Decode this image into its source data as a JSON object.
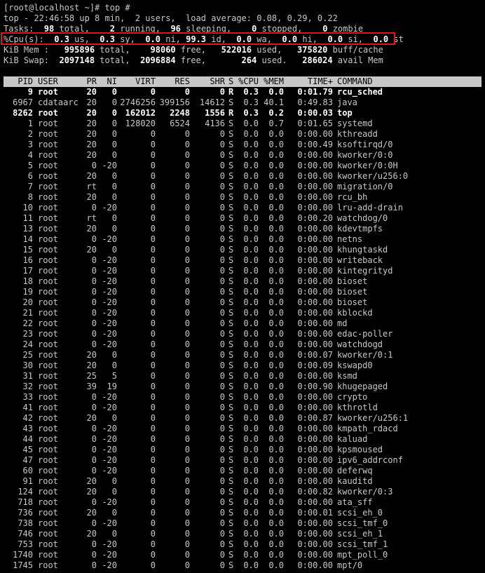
{
  "prompt": "[root@localhost ~]# top #",
  "summary": {
    "top": "top - 22:46:58 up 8 min,  2 users,  load average: 0.08, 0.29, 0.22",
    "tasks": [
      {
        "t": "Tasks: ",
        "b": false
      },
      {
        "t": " 98",
        "b": true
      },
      {
        "t": " total,  ",
        "b": false
      },
      {
        "t": "  2",
        "b": true
      },
      {
        "t": " running, ",
        "b": false
      },
      {
        "t": " 96",
        "b": true
      },
      {
        "t": " sleeping,  ",
        "b": false
      },
      {
        "t": "  0",
        "b": true
      },
      {
        "t": " stopped,  ",
        "b": false
      },
      {
        "t": "  0",
        "b": true
      },
      {
        "t": " zombie",
        "b": false
      }
    ],
    "cpu": [
      {
        "t": "%Cpu(s): ",
        "b": false
      },
      {
        "t": " 0.3",
        "b": true
      },
      {
        "t": " us, ",
        "b": false
      },
      {
        "t": " 0.3",
        "b": true
      },
      {
        "t": " sy, ",
        "b": false
      },
      {
        "t": " 0.0",
        "b": true
      },
      {
        "t": " ni, ",
        "b": false
      },
      {
        "t": "99.3",
        "b": true
      },
      {
        "t": " id, ",
        "b": false
      },
      {
        "t": " 0.0",
        "b": true
      },
      {
        "t": " wa, ",
        "b": false
      },
      {
        "t": " 0.0",
        "b": true
      },
      {
        "t": " hi, ",
        "b": false
      },
      {
        "t": " 0.0",
        "b": true
      },
      {
        "t": " si, ",
        "b": false
      },
      {
        "t": " 0.0",
        "b": true
      },
      {
        "t": " st",
        "b": false
      }
    ],
    "mem": [
      {
        "t": "KiB Mem : ",
        "b": false
      },
      {
        "t": "  995896",
        "b": true
      },
      {
        "t": " total,  ",
        "b": false
      },
      {
        "t": "  98060",
        "b": true
      },
      {
        "t": " free,  ",
        "b": false
      },
      {
        "t": " 522016",
        "b": true
      },
      {
        "t": " used,  ",
        "b": false
      },
      {
        "t": " 375820",
        "b": true
      },
      {
        "t": " buff/cache",
        "b": false
      }
    ],
    "swap": [
      {
        "t": "KiB Swap: ",
        "b": false
      },
      {
        "t": " 2097148",
        "b": true
      },
      {
        "t": " total, ",
        "b": false
      },
      {
        "t": " 2096884",
        "b": true
      },
      {
        "t": " free,  ",
        "b": false
      },
      {
        "t": "     264",
        "b": true
      },
      {
        "t": " used.  ",
        "b": false
      },
      {
        "t": " 286024",
        "b": true
      },
      {
        "t": " avail Mem",
        "b": false
      }
    ]
  },
  "columns": [
    "PID",
    "USER",
    "PR",
    "NI",
    "VIRT",
    "RES",
    "SHR",
    "S",
    "%CPU",
    "%MEM",
    "TIME+",
    "COMMAND"
  ],
  "processes": [
    {
      "pid": "9",
      "user": "root",
      "pr": "20",
      "ni": "0",
      "virt": "0",
      "res": "0",
      "shr": "0",
      "s": "R",
      "cpu": "0.3",
      "mem": "0.0",
      "time": "0:01.79",
      "cmd": "rcu_sched",
      "bold": true
    },
    {
      "pid": "6967",
      "user": "cdataarc",
      "pr": "20",
      "ni": "0",
      "virt": "2746256",
      "res": "399156",
      "shr": "14612",
      "s": "S",
      "cpu": "0.3",
      "mem": "40.1",
      "time": "0:49.83",
      "cmd": "java",
      "bold": false
    },
    {
      "pid": "8262",
      "user": "root",
      "pr": "20",
      "ni": "0",
      "virt": "162012",
      "res": "2248",
      "shr": "1556",
      "s": "R",
      "cpu": "0.3",
      "mem": "0.2",
      "time": "0:00.03",
      "cmd": "top",
      "bold": true
    },
    {
      "pid": "1",
      "user": "root",
      "pr": "20",
      "ni": "0",
      "virt": "128020",
      "res": "6524",
      "shr": "4136",
      "s": "S",
      "cpu": "0.0",
      "mem": "0.7",
      "time": "0:01.65",
      "cmd": "systemd",
      "bold": false
    },
    {
      "pid": "2",
      "user": "root",
      "pr": "20",
      "ni": "0",
      "virt": "0",
      "res": "0",
      "shr": "0",
      "s": "S",
      "cpu": "0.0",
      "mem": "0.0",
      "time": "0:00.00",
      "cmd": "kthreadd",
      "bold": false
    },
    {
      "pid": "3",
      "user": "root",
      "pr": "20",
      "ni": "0",
      "virt": "0",
      "res": "0",
      "shr": "0",
      "s": "S",
      "cpu": "0.0",
      "mem": "0.0",
      "time": "0:00.49",
      "cmd": "ksoftirqd/0",
      "bold": false
    },
    {
      "pid": "4",
      "user": "root",
      "pr": "20",
      "ni": "0",
      "virt": "0",
      "res": "0",
      "shr": "0",
      "s": "S",
      "cpu": "0.0",
      "mem": "0.0",
      "time": "0:00.00",
      "cmd": "kworker/0:0",
      "bold": false
    },
    {
      "pid": "5",
      "user": "root",
      "pr": "0",
      "ni": "-20",
      "virt": "0",
      "res": "0",
      "shr": "0",
      "s": "S",
      "cpu": "0.0",
      "mem": "0.0",
      "time": "0:00.00",
      "cmd": "kworker/0:0H",
      "bold": false
    },
    {
      "pid": "6",
      "user": "root",
      "pr": "20",
      "ni": "0",
      "virt": "0",
      "res": "0",
      "shr": "0",
      "s": "S",
      "cpu": "0.0",
      "mem": "0.0",
      "time": "0:00.00",
      "cmd": "kworker/u256:0",
      "bold": false
    },
    {
      "pid": "7",
      "user": "root",
      "pr": "rt",
      "ni": "0",
      "virt": "0",
      "res": "0",
      "shr": "0",
      "s": "S",
      "cpu": "0.0",
      "mem": "0.0",
      "time": "0:00.00",
      "cmd": "migration/0",
      "bold": false
    },
    {
      "pid": "8",
      "user": "root",
      "pr": "20",
      "ni": "0",
      "virt": "0",
      "res": "0",
      "shr": "0",
      "s": "S",
      "cpu": "0.0",
      "mem": "0.0",
      "time": "0:00.00",
      "cmd": "rcu_bh",
      "bold": false
    },
    {
      "pid": "10",
      "user": "root",
      "pr": "0",
      "ni": "-20",
      "virt": "0",
      "res": "0",
      "shr": "0",
      "s": "S",
      "cpu": "0.0",
      "mem": "0.0",
      "time": "0:00.00",
      "cmd": "lru-add-drain",
      "bold": false
    },
    {
      "pid": "11",
      "user": "root",
      "pr": "rt",
      "ni": "0",
      "virt": "0",
      "res": "0",
      "shr": "0",
      "s": "S",
      "cpu": "0.0",
      "mem": "0.0",
      "time": "0:00.20",
      "cmd": "watchdog/0",
      "bold": false
    },
    {
      "pid": "13",
      "user": "root",
      "pr": "20",
      "ni": "0",
      "virt": "0",
      "res": "0",
      "shr": "0",
      "s": "S",
      "cpu": "0.0",
      "mem": "0.0",
      "time": "0:00.00",
      "cmd": "kdevtmpfs",
      "bold": false
    },
    {
      "pid": "14",
      "user": "root",
      "pr": "0",
      "ni": "-20",
      "virt": "0",
      "res": "0",
      "shr": "0",
      "s": "S",
      "cpu": "0.0",
      "mem": "0.0",
      "time": "0:00.00",
      "cmd": "netns",
      "bold": false
    },
    {
      "pid": "15",
      "user": "root",
      "pr": "20",
      "ni": "0",
      "virt": "0",
      "res": "0",
      "shr": "0",
      "s": "S",
      "cpu": "0.0",
      "mem": "0.0",
      "time": "0:00.00",
      "cmd": "khungtaskd",
      "bold": false
    },
    {
      "pid": "16",
      "user": "root",
      "pr": "0",
      "ni": "-20",
      "virt": "0",
      "res": "0",
      "shr": "0",
      "s": "S",
      "cpu": "0.0",
      "mem": "0.0",
      "time": "0:00.00",
      "cmd": "writeback",
      "bold": false
    },
    {
      "pid": "17",
      "user": "root",
      "pr": "0",
      "ni": "-20",
      "virt": "0",
      "res": "0",
      "shr": "0",
      "s": "S",
      "cpu": "0.0",
      "mem": "0.0",
      "time": "0:00.00",
      "cmd": "kintegrityd",
      "bold": false
    },
    {
      "pid": "18",
      "user": "root",
      "pr": "0",
      "ni": "-20",
      "virt": "0",
      "res": "0",
      "shr": "0",
      "s": "S",
      "cpu": "0.0",
      "mem": "0.0",
      "time": "0:00.00",
      "cmd": "bioset",
      "bold": false
    },
    {
      "pid": "19",
      "user": "root",
      "pr": "0",
      "ni": "-20",
      "virt": "0",
      "res": "0",
      "shr": "0",
      "s": "S",
      "cpu": "0.0",
      "mem": "0.0",
      "time": "0:00.00",
      "cmd": "bioset",
      "bold": false
    },
    {
      "pid": "20",
      "user": "root",
      "pr": "0",
      "ni": "-20",
      "virt": "0",
      "res": "0",
      "shr": "0",
      "s": "S",
      "cpu": "0.0",
      "mem": "0.0",
      "time": "0:00.00",
      "cmd": "bioset",
      "bold": false
    },
    {
      "pid": "21",
      "user": "root",
      "pr": "0",
      "ni": "-20",
      "virt": "0",
      "res": "0",
      "shr": "0",
      "s": "S",
      "cpu": "0.0",
      "mem": "0.0",
      "time": "0:00.00",
      "cmd": "kblockd",
      "bold": false
    },
    {
      "pid": "22",
      "user": "root",
      "pr": "0",
      "ni": "-20",
      "virt": "0",
      "res": "0",
      "shr": "0",
      "s": "S",
      "cpu": "0.0",
      "mem": "0.0",
      "time": "0:00.00",
      "cmd": "md",
      "bold": false
    },
    {
      "pid": "23",
      "user": "root",
      "pr": "0",
      "ni": "-20",
      "virt": "0",
      "res": "0",
      "shr": "0",
      "s": "S",
      "cpu": "0.0",
      "mem": "0.0",
      "time": "0:00.00",
      "cmd": "edac-poller",
      "bold": false
    },
    {
      "pid": "24",
      "user": "root",
      "pr": "0",
      "ni": "-20",
      "virt": "0",
      "res": "0",
      "shr": "0",
      "s": "S",
      "cpu": "0.0",
      "mem": "0.0",
      "time": "0:00.00",
      "cmd": "watchdogd",
      "bold": false
    },
    {
      "pid": "25",
      "user": "root",
      "pr": "20",
      "ni": "0",
      "virt": "0",
      "res": "0",
      "shr": "0",
      "s": "S",
      "cpu": "0.0",
      "mem": "0.0",
      "time": "0:00.07",
      "cmd": "kworker/0:1",
      "bold": false
    },
    {
      "pid": "30",
      "user": "root",
      "pr": "20",
      "ni": "0",
      "virt": "0",
      "res": "0",
      "shr": "0",
      "s": "S",
      "cpu": "0.0",
      "mem": "0.0",
      "time": "0:00.09",
      "cmd": "kswapd0",
      "bold": false
    },
    {
      "pid": "31",
      "user": "root",
      "pr": "25",
      "ni": "5",
      "virt": "0",
      "res": "0",
      "shr": "0",
      "s": "S",
      "cpu": "0.0",
      "mem": "0.0",
      "time": "0:00.00",
      "cmd": "ksmd",
      "bold": false
    },
    {
      "pid": "32",
      "user": "root",
      "pr": "39",
      "ni": "19",
      "virt": "0",
      "res": "0",
      "shr": "0",
      "s": "S",
      "cpu": "0.0",
      "mem": "0.0",
      "time": "0:00.90",
      "cmd": "khugepaged",
      "bold": false
    },
    {
      "pid": "33",
      "user": "root",
      "pr": "0",
      "ni": "-20",
      "virt": "0",
      "res": "0",
      "shr": "0",
      "s": "S",
      "cpu": "0.0",
      "mem": "0.0",
      "time": "0:00.00",
      "cmd": "crypto",
      "bold": false
    },
    {
      "pid": "41",
      "user": "root",
      "pr": "0",
      "ni": "-20",
      "virt": "0",
      "res": "0",
      "shr": "0",
      "s": "S",
      "cpu": "0.0",
      "mem": "0.0",
      "time": "0:00.00",
      "cmd": "kthrotld",
      "bold": false
    },
    {
      "pid": "42",
      "user": "root",
      "pr": "20",
      "ni": "0",
      "virt": "0",
      "res": "0",
      "shr": "0",
      "s": "S",
      "cpu": "0.0",
      "mem": "0.0",
      "time": "0:00.87",
      "cmd": "kworker/u256:1",
      "bold": false
    },
    {
      "pid": "43",
      "user": "root",
      "pr": "0",
      "ni": "-20",
      "virt": "0",
      "res": "0",
      "shr": "0",
      "s": "S",
      "cpu": "0.0",
      "mem": "0.0",
      "time": "0:00.00",
      "cmd": "kmpath_rdacd",
      "bold": false
    },
    {
      "pid": "44",
      "user": "root",
      "pr": "0",
      "ni": "-20",
      "virt": "0",
      "res": "0",
      "shr": "0",
      "s": "S",
      "cpu": "0.0",
      "mem": "0.0",
      "time": "0:00.00",
      "cmd": "kaluad",
      "bold": false
    },
    {
      "pid": "45",
      "user": "root",
      "pr": "0",
      "ni": "-20",
      "virt": "0",
      "res": "0",
      "shr": "0",
      "s": "S",
      "cpu": "0.0",
      "mem": "0.0",
      "time": "0:00.00",
      "cmd": "kpsmoused",
      "bold": false
    },
    {
      "pid": "47",
      "user": "root",
      "pr": "0",
      "ni": "-20",
      "virt": "0",
      "res": "0",
      "shr": "0",
      "s": "S",
      "cpu": "0.0",
      "mem": "0.0",
      "time": "0:00.00",
      "cmd": "ipv6_addrconf",
      "bold": false
    },
    {
      "pid": "60",
      "user": "root",
      "pr": "0",
      "ni": "-20",
      "virt": "0",
      "res": "0",
      "shr": "0",
      "s": "S",
      "cpu": "0.0",
      "mem": "0.0",
      "time": "0:00.00",
      "cmd": "deferwq",
      "bold": false
    },
    {
      "pid": "91",
      "user": "root",
      "pr": "20",
      "ni": "0",
      "virt": "0",
      "res": "0",
      "shr": "0",
      "s": "S",
      "cpu": "0.0",
      "mem": "0.0",
      "time": "0:00.00",
      "cmd": "kauditd",
      "bold": false
    },
    {
      "pid": "124",
      "user": "root",
      "pr": "20",
      "ni": "0",
      "virt": "0",
      "res": "0",
      "shr": "0",
      "s": "S",
      "cpu": "0.0",
      "mem": "0.0",
      "time": "0:00.82",
      "cmd": "kworker/0:3",
      "bold": false
    },
    {
      "pid": "718",
      "user": "root",
      "pr": "0",
      "ni": "-20",
      "virt": "0",
      "res": "0",
      "shr": "0",
      "s": "S",
      "cpu": "0.0",
      "mem": "0.0",
      "time": "0:00.00",
      "cmd": "ata_sff",
      "bold": false
    },
    {
      "pid": "736",
      "user": "root",
      "pr": "20",
      "ni": "0",
      "virt": "0",
      "res": "0",
      "shr": "0",
      "s": "S",
      "cpu": "0.0",
      "mem": "0.0",
      "time": "0:00.01",
      "cmd": "scsi_eh_0",
      "bold": false
    },
    {
      "pid": "738",
      "user": "root",
      "pr": "0",
      "ni": "-20",
      "virt": "0",
      "res": "0",
      "shr": "0",
      "s": "S",
      "cpu": "0.0",
      "mem": "0.0",
      "time": "0:00.00",
      "cmd": "scsi_tmf_0",
      "bold": false
    },
    {
      "pid": "746",
      "user": "root",
      "pr": "20",
      "ni": "0",
      "virt": "0",
      "res": "0",
      "shr": "0",
      "s": "S",
      "cpu": "0.0",
      "mem": "0.0",
      "time": "0:00.00",
      "cmd": "scsi_eh_1",
      "bold": false
    },
    {
      "pid": "753",
      "user": "root",
      "pr": "0",
      "ni": "-20",
      "virt": "0",
      "res": "0",
      "shr": "0",
      "s": "S",
      "cpu": "0.0",
      "mem": "0.0",
      "time": "0:00.00",
      "cmd": "scsi_tmf_1",
      "bold": false
    },
    {
      "pid": "1740",
      "user": "root",
      "pr": "0",
      "ni": "-20",
      "virt": "0",
      "res": "0",
      "shr": "0",
      "s": "S",
      "cpu": "0.0",
      "mem": "0.0",
      "time": "0:00.00",
      "cmd": "mpt_poll_0",
      "bold": false
    },
    {
      "pid": "1745",
      "user": "root",
      "pr": "0",
      "ni": "-20",
      "virt": "0",
      "res": "0",
      "shr": "0",
      "s": "S",
      "cpu": "0.0",
      "mem": "0.0",
      "time": "0:00.00",
      "cmd": "mpt/0",
      "bold": false
    }
  ],
  "colors": {
    "background": "#000000",
    "text": "#c8c8c8",
    "bold_text": "#ffffff",
    "header_bar": "#c8c8c8",
    "highlight_box": "#e0161a"
  }
}
